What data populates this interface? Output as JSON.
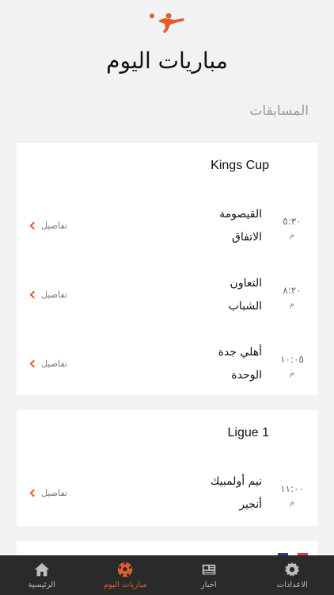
{
  "header": {
    "title": "مباريات اليوم",
    "logo_icon": "footballer-kick-icon",
    "accent_color": "#e35d2a"
  },
  "section": {
    "label": "المسابقات"
  },
  "competitions": [
    {
      "name": "Kings Cup",
      "matches": [
        {
          "time": "٥:٣٠",
          "ampm": "م",
          "home": "القيصومة",
          "away": "الاتفاق",
          "details": "تفاصيل"
        },
        {
          "time": "٨:٢٠",
          "ampm": "م",
          "home": "التعاون",
          "away": "الشباب",
          "details": "تفاصيل"
        },
        {
          "time": "١٠:٠٥",
          "ampm": "م",
          "home": "أهلي جدة",
          "away": "الوحدة",
          "details": "تفاصيل"
        }
      ]
    },
    {
      "name": "Ligue 1",
      "matches": [
        {
          "time": "١١:٠٠",
          "ampm": "م",
          "home": "نيم أولمبيك",
          "away": "أنجير",
          "details": "تفاصيل"
        }
      ]
    }
  ],
  "tabbar": {
    "settings": "الاعدادات",
    "news": "اخبار",
    "today": "مباريات اليوم",
    "home": "الرئيسية"
  }
}
